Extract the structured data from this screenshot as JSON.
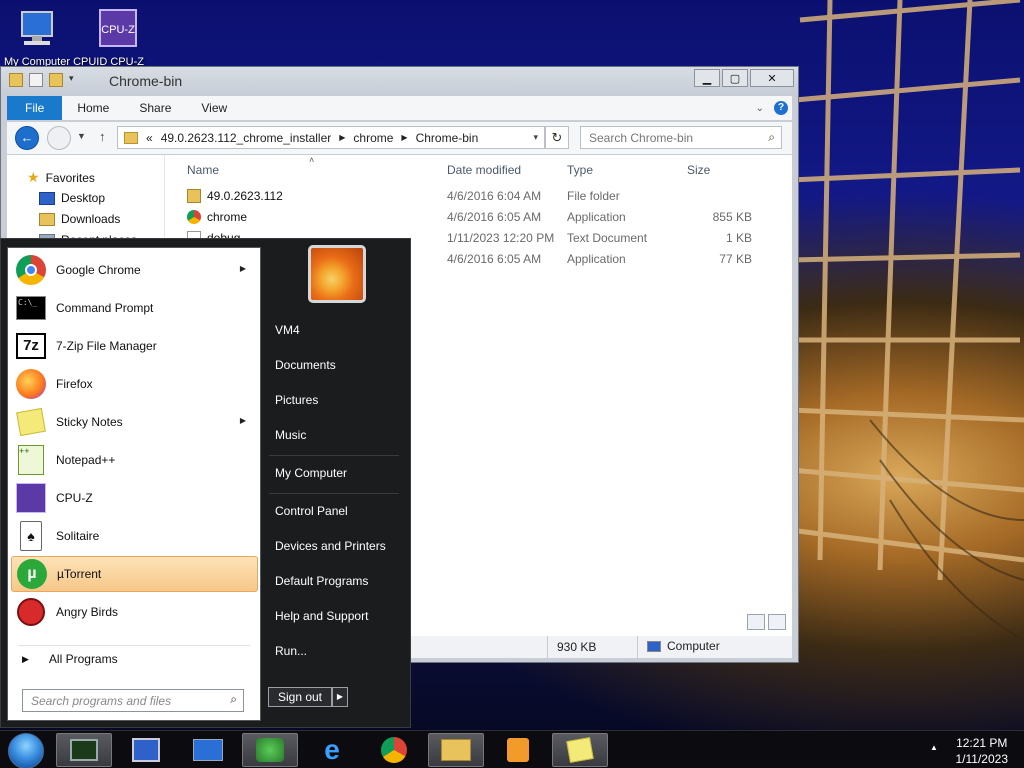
{
  "desktop": {
    "icons": [
      {
        "label": "My Computer",
        "icon": "computer-icon"
      },
      {
        "label": "CPUID CPU-Z",
        "icon": "cpu-z-icon"
      }
    ],
    "icon_label_row": "My Computer CPUID CPU-Z"
  },
  "explorer": {
    "title": "Chrome-bin",
    "ribbon_tabs": [
      "File",
      "Home",
      "Share",
      "View"
    ],
    "address": {
      "overflow": "«",
      "crumbs": [
        "49.0.2623.112_chrome_installer",
        "chrome",
        "Chrome-bin"
      ]
    },
    "search_placeholder": "Search Chrome-bin",
    "nav_pane": {
      "favorites": "Favorites",
      "items": [
        "Desktop",
        "Downloads",
        "Recent places"
      ]
    },
    "columns": {
      "name": "Name",
      "date": "Date modified",
      "type": "Type",
      "size": "Size"
    },
    "files": [
      {
        "name": "49.0.2623.112",
        "date": "4/6/2016 6:04 AM",
        "type": "File folder",
        "size": "",
        "icon": "folder-icon"
      },
      {
        "name": "chrome",
        "date": "4/6/2016 6:05 AM",
        "type": "Application",
        "size": "855 KB",
        "icon": "chrome-icon"
      },
      {
        "name": "debug",
        "date": "1/11/2023 12:20 PM",
        "type": "Text Document",
        "size": "1 KB",
        "icon": "text-file-icon"
      },
      {
        "name": "er",
        "date": "4/6/2016 6:05 AM",
        "type": "Application",
        "size": "77 KB",
        "icon": "app-icon"
      }
    ],
    "status": {
      "size": "930 KB",
      "location": "Computer"
    }
  },
  "start_menu": {
    "programs": [
      {
        "label": "Google Chrome",
        "icon": "chrome-icon",
        "submenu": true
      },
      {
        "label": "Command Prompt",
        "icon": "cmd-icon",
        "submenu": false
      },
      {
        "label": "7-Zip File Manager",
        "icon": "7zip-icon",
        "submenu": false
      },
      {
        "label": "Firefox",
        "icon": "firefox-icon",
        "submenu": false
      },
      {
        "label": "Sticky Notes",
        "icon": "sticky-notes-icon",
        "submenu": true
      },
      {
        "label": "Notepad++",
        "icon": "notepadpp-icon",
        "submenu": false
      },
      {
        "label": "CPU-Z",
        "icon": "cpu-z-icon",
        "submenu": false
      },
      {
        "label": "Solitaire",
        "icon": "solitaire-icon",
        "submenu": false
      },
      {
        "label": "µTorrent",
        "icon": "utorrent-icon",
        "submenu": false
      },
      {
        "label": "Angry Birds",
        "icon": "angry-birds-icon",
        "submenu": false
      }
    ],
    "all_programs": "All Programs",
    "search_placeholder": "Search programs and files",
    "right_items": [
      "VM4",
      "Documents",
      "Pictures",
      "Music",
      "My Computer",
      "Control Panel",
      "Devices and Printers",
      "Default Programs",
      "Help and Support",
      "Run..."
    ],
    "sign_out": "Sign out"
  },
  "taskbar": {
    "buttons": [
      "task-manager-icon",
      "remote-desktop-icon",
      "desktop-icon",
      "network-icon",
      "internet-explorer-icon",
      "chrome-icon",
      "file-explorer-icon",
      "media-player-icon",
      "sticky-notes-icon"
    ],
    "time": "12:21 PM",
    "date": "1/11/2023"
  },
  "colors": {
    "accent": "#1979ca",
    "highlight": "#f7c788",
    "start_bg": "#1b1c1e"
  }
}
